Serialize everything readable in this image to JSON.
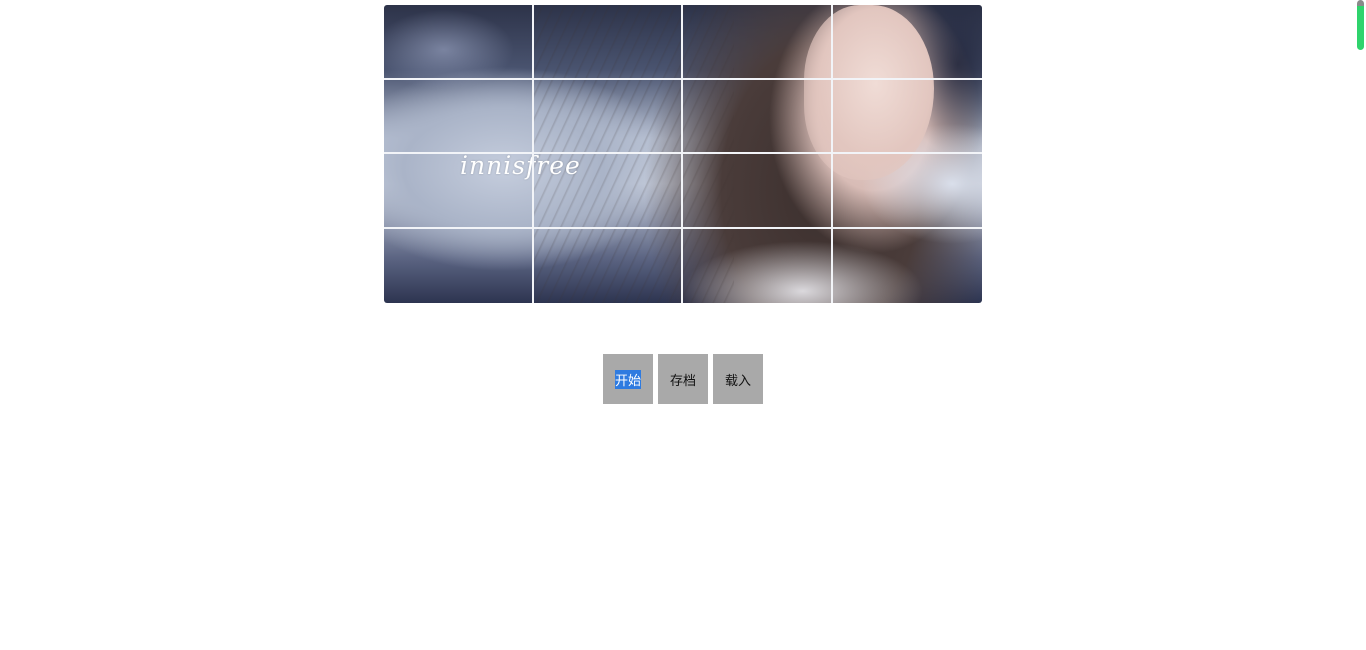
{
  "puzzle": {
    "rows": 4,
    "columns": 4,
    "image_text": "innisfree"
  },
  "controls": {
    "start_label": "开始",
    "save_label": "存档",
    "load_label": "载入"
  },
  "colors": {
    "button_bg": "#a9a9a9",
    "tile_border": "#f2f4f8",
    "selection": "#2f7be0",
    "scrollbar_thumb": "#2fd36c"
  }
}
